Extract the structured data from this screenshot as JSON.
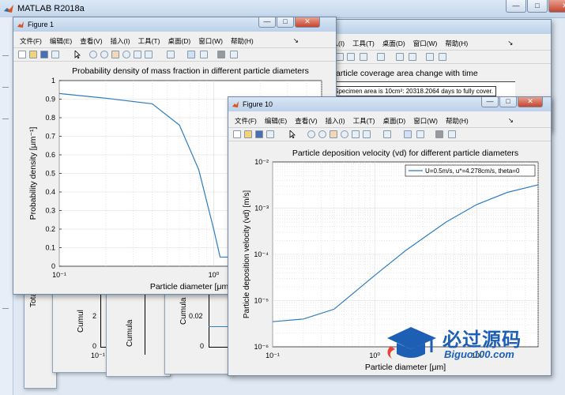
{
  "app": {
    "title": "MATLAB R2018a",
    "min": "—",
    "max": "□",
    "close": "✕"
  },
  "menu": [
    "文件(F)",
    "编辑(E)",
    "查看(V)",
    "插入(I)",
    "工具(T)",
    "桌面(D)",
    "窗口(W)",
    "帮助(H)"
  ],
  "menu_arrow": "↘",
  "back_menu": [
    "插入(I)",
    "工具(T)",
    "桌面(D)",
    "窗口(W)",
    "帮助(H)"
  ],
  "figure1": {
    "title": "Figure 1",
    "chart_data": {
      "type": "line",
      "title": "Probability density of mass fraction in different particle diameters",
      "xlabel": "Particle diameter [μm]",
      "ylabel": "Probability density [μm⁻¹]",
      "xscale": "log",
      "xlim": [
        0.1,
        5
      ],
      "ylim": [
        0,
        1
      ],
      "xticks": [
        "10⁻¹",
        "10⁰"
      ],
      "yticks": [
        "0",
        "0.1",
        "0.2",
        "0.3",
        "0.4",
        "0.5",
        "0.6",
        "0.7",
        "0.8",
        "0.9",
        "1"
      ],
      "grid": true,
      "x": [
        0.1,
        0.2,
        0.4,
        0.6,
        0.8,
        1.0,
        1.1,
        2.0,
        3.0,
        5.0
      ],
      "y": [
        0.93,
        0.905,
        0.875,
        0.76,
        0.52,
        0.2,
        0.05,
        0.046,
        0.046,
        0.046
      ]
    }
  },
  "figure10": {
    "title": "Figure 10",
    "chart_data": {
      "type": "line",
      "title": "Particle deposition velocity (vd) for different particle diameters",
      "xlabel": "Particle diameter [μm]",
      "ylabel": "Particle deposition velocity (vd) [m/s]",
      "xscale": "log",
      "yscale": "log",
      "xlim": [
        0.1,
        40
      ],
      "ylim": [
        1e-06,
        0.01
      ],
      "xticks": [
        "10⁻¹",
        "10⁰",
        "10¹"
      ],
      "yticks": [
        "10⁻⁶",
        "10⁻⁵",
        "10⁻⁴",
        "10⁻³",
        "10⁻²"
      ],
      "grid": true,
      "legend": "U=0.5m/s, u*=4.278cm/s, theta=0",
      "legend_position": "top-right",
      "x": [
        0.1,
        0.2,
        0.4,
        1.0,
        2.0,
        5.0,
        10.0,
        20.0,
        40.0
      ],
      "y": [
        3.5e-06,
        4e-06,
        6.5e-06,
        3.5e-05,
        0.00012,
        0.0005,
        0.0012,
        0.0022,
        0.0032
      ]
    }
  },
  "figure_back": {
    "title": "article coverage area change with time",
    "note": "Specimen area is 10cm²: 20318.2064 days to fully cover."
  },
  "background_figs": {
    "labels": [
      "Total",
      "Cumul",
      "Cumula",
      "Cumula"
    ],
    "ticks_a": [
      "2",
      "0",
      "10⁻¹"
    ],
    "ticks_b": [
      "0.02",
      "0"
    ]
  },
  "watermark": {
    "cn": "必过源码",
    "url": "Biguo100.com"
  }
}
